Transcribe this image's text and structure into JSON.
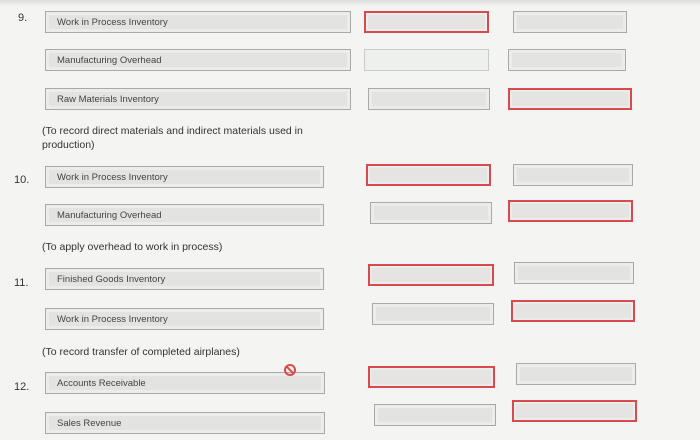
{
  "entries": [
    {
      "number": "9.",
      "rows": [
        {
          "account": "Work in Process Inventory",
          "debit_state": "error",
          "credit_state": "normal"
        },
        {
          "account": "Manufacturing Overhead",
          "debit_state": "pale",
          "credit_state": "normal"
        },
        {
          "account": "Raw Materials Inventory",
          "debit_state": "normal",
          "credit_state": "error"
        }
      ],
      "memo": "(To record direct materials and indirect materials used in production)"
    },
    {
      "number": "10.",
      "rows": [
        {
          "account": "Work in Process Inventory",
          "debit_state": "error",
          "credit_state": "normal"
        },
        {
          "account": "Manufacturing Overhead",
          "debit_state": "normal",
          "credit_state": "error"
        }
      ],
      "memo": "(To apply overhead to work in process)"
    },
    {
      "number": "11.",
      "rows": [
        {
          "account": "Finished Goods Inventory",
          "debit_state": "error",
          "credit_state": "normal"
        },
        {
          "account": "Work in Process Inventory",
          "debit_state": "normal",
          "credit_state": "error"
        }
      ],
      "memo": "(To record transfer of completed airplanes)"
    },
    {
      "number": "12.",
      "rows": [
        {
          "account": "Accounts Receivable",
          "debit_state": "error",
          "credit_state": "normal"
        },
        {
          "account": "Sales Revenue",
          "debit_state": "normal",
          "credit_state": "error"
        }
      ],
      "memo": ""
    }
  ],
  "icons": {
    "error_indicator": "prohibited-circle-icon"
  },
  "colors": {
    "error_border": "#d94a4f",
    "field_bg": "#e3e3e1",
    "page_bg": "#f4f4f2"
  }
}
